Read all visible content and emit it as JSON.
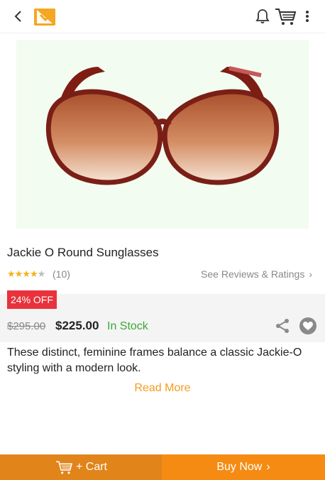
{
  "header": {
    "back_icon": "back-arrow-icon",
    "logo_icon": "brand-logo-icon",
    "notification_icon": "bell-icon",
    "cart_icon": "cart-icon",
    "more_icon": "more-vertical-icon"
  },
  "product": {
    "image": "sunglasses-product-image",
    "title": "Jackie O Round Sunglasses",
    "rating": 4.5,
    "review_count": "(10)",
    "reviews_link": "See Reviews & Ratings",
    "discount_badge": "24% OFF",
    "old_price": "$295.00",
    "price": "$225.00",
    "stock_status": "In Stock",
    "description": "These distinct, feminine frames balance a classic Jackie-O styling with a modern look.",
    "read_more": "Read More"
  },
  "actions": {
    "add_to_cart": "+ Cart",
    "buy_now": "Buy Now"
  },
  "colors": {
    "accent_orange": "#f58b12",
    "add_cart_orange": "#e1841a",
    "discount_red": "#e8323c",
    "stock_green": "#3aa935",
    "star_gold": "#f2b21b",
    "link_orange": "#f39c1f"
  }
}
